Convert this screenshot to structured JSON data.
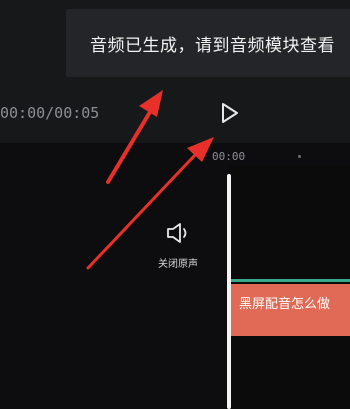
{
  "toast": {
    "message": "音频已生成，请到音频模块查看"
  },
  "player": {
    "time_display": "00:00/00:05",
    "play_icon": "play-icon"
  },
  "timeline": {
    "ruler_time": "00:00",
    "mute_button": {
      "label": "关闭原声",
      "icon": "speaker-icon"
    },
    "audio_clip": {
      "label": "黑屏配音怎么做"
    }
  },
  "annotations": {
    "arrow_color": "#e8302a"
  },
  "colors": {
    "background": "#0d0d0f",
    "toolbar": "#17181a",
    "toast": "#242528",
    "clip": "#e06a55",
    "clip_line": "#3aa88a"
  }
}
